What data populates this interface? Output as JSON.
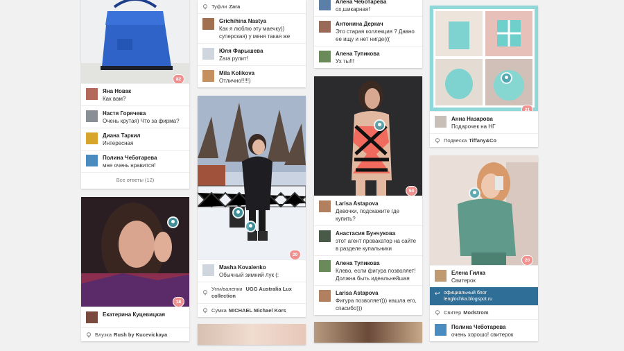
{
  "col1": {
    "card1": {
      "likes": "82",
      "comments": [
        {
          "name": "Яна Новак",
          "text": "Как вам?"
        },
        {
          "name": "Настя Горячева",
          "text": "Очень крутая) Что за фирма?"
        },
        {
          "name": "Диана Таркил",
          "text": "Интересная"
        },
        {
          "name": "Полина Чеботарева",
          "text": "мне очень нравится!"
        }
      ],
      "more_label": "Все ответы (12)"
    },
    "card2": {
      "likes": "18",
      "comments": [
        {
          "name": "Екатерина Куцевицкая",
          "text": ""
        }
      ],
      "tag": {
        "prefix": "Блузка",
        "brand": "Rush by Kucevickaya"
      }
    }
  },
  "col2": {
    "card1": {
      "tag": {
        "prefix": "Туфли",
        "brand": "Zara"
      },
      "comments": [
        {
          "name": "Grichihina Nastya",
          "text": "Как я люблю эту маечку)) суперская) у меня такая же"
        },
        {
          "name": "Юля Фарышева",
          "text": "Zara рулит!"
        },
        {
          "name": "Mila Kolikova",
          "text": "Отлично!!!!!)"
        }
      ]
    },
    "card2": {
      "likes": "20",
      "comments": [
        {
          "name": "Masha Kovalenko",
          "text": "Обычный зимний лук (:"
        }
      ],
      "tags": [
        {
          "prefix": "Угги/валенки",
          "brand": "UGG Australia Lux collection"
        },
        {
          "prefix": "Сумка",
          "brand": "MICHAEL Michael Kors"
        }
      ]
    }
  },
  "col3": {
    "card1": {
      "comments": [
        {
          "name": "Алена Чеботарева",
          "text": "ох,шикарная!"
        },
        {
          "name": "Антонина Деркач",
          "text": "Это старая коллекция ? Давно ее ищу и нет нигде((("
        },
        {
          "name": "Алена Тупикова",
          "text": "Ух ты!!!"
        }
      ]
    },
    "card2": {
      "likes": "54",
      "comments": [
        {
          "name": "Larisa Astapova",
          "text": "Девочки, подскажите где купить?"
        },
        {
          "name": "Анастасия Бунчукова",
          "text": "этот агент провакатор на сайте в разделе купальники"
        },
        {
          "name": "Алена Тупикова",
          "text": "Клево, если фигура позволяет! Должна быть идеальнейшая"
        },
        {
          "name": "Larisa Astapova",
          "text": "Фигура позволяет))) нашла его, спасибо)))"
        }
      ]
    }
  },
  "col4": {
    "card1": {
      "likes": "21",
      "comments": [
        {
          "name": "Анна Назарова",
          "text": "Подарочек на НГ"
        }
      ],
      "tag": {
        "prefix": "Подвеска",
        "brand": "Tiffany&Co"
      }
    },
    "card2": {
      "likes": "20",
      "comments": [
        {
          "name": "Елена Гилка",
          "text": "Свитерок"
        }
      ],
      "blog": {
        "line1": "официальный блог",
        "line2": "lenglochka.blogspot.ru"
      },
      "tag": {
        "prefix": "Свитер",
        "brand": "Modstrom"
      },
      "comments2": [
        {
          "name": "Полина Чеботарева",
          "text": "очень хорошо! свитерок"
        }
      ]
    }
  },
  "colors": {
    "accent": "#2f6e96",
    "heart": "#f0908f",
    "pin": "#46a0aa"
  }
}
